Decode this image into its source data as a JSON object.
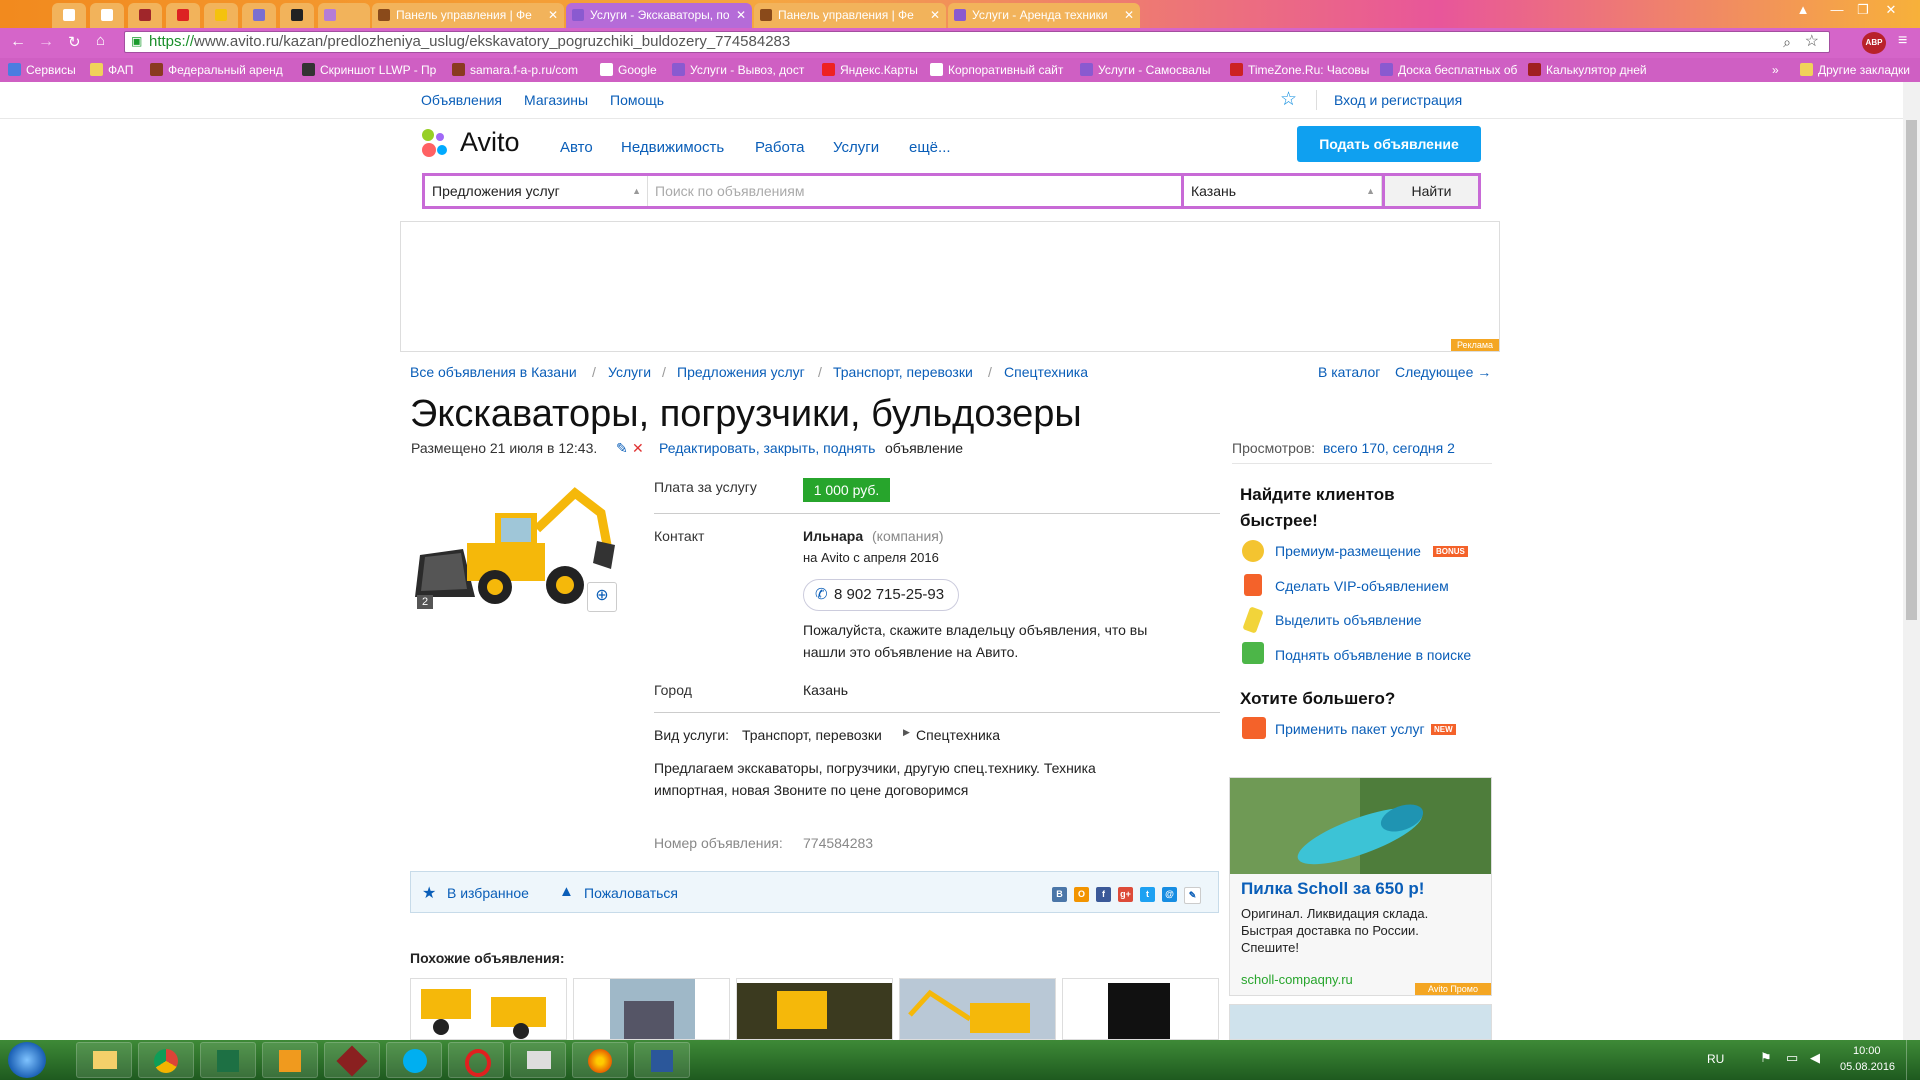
{
  "browser": {
    "tabs": [
      {
        "label": "",
        "pinned": true
      },
      {
        "label": "",
        "pinned": true
      },
      {
        "label": "",
        "pinned": true
      },
      {
        "label": "",
        "pinned": true
      },
      {
        "label": "",
        "pinned": true
      },
      {
        "label": "",
        "pinned": true
      },
      {
        "label": "",
        "pinned": true
      },
      {
        "label": "Панель управления | Фе",
        "pinned": false
      },
      {
        "label": "Услуги - Экскаваторы, по",
        "pinned": false,
        "active": true
      },
      {
        "label": "Панель управления | Фе",
        "pinned": false
      },
      {
        "label": "Услуги - Аренда техники",
        "pinned": false
      }
    ],
    "url_scheme": "https://",
    "url_rest": "www.avito.ru/kazan/predlozheniya_uslug/ekskavatory_pogruzchiki_buldozery_774584283",
    "extension_badge": "ABP 21",
    "bookmarks": [
      "Сервисы",
      "ФАП",
      "Федеральный аренд",
      "Скриншот LLWP - Пр",
      "samara.f-a-p.ru/com",
      "Google",
      "Услуги - Вывоз, дост",
      "Яндекс.Карты",
      "Корпоративный сайт",
      "Услуги - Самосвалы",
      "TimeZone.Ru: Часовы",
      "Доска бесплатных об",
      "Калькулятор дней"
    ],
    "other_bookmarks": "Другие закладки",
    "more_bookmarks": "»"
  },
  "header": {
    "top_links": [
      "Объявления",
      "Магазины",
      "Помощь"
    ],
    "login": "Вход и регистрация",
    "logo_text": "Avito",
    "nav": [
      "Авто",
      "Недвижимость",
      "Работа",
      "Услуги",
      "ещё..."
    ],
    "post_button": "Подать объявление"
  },
  "search": {
    "category": "Предложения услуг",
    "placeholder": "Поиск по объявлениям",
    "city": "Казань",
    "button": "Найти"
  },
  "ad_label": "Реклама",
  "breadcrumbs": [
    "Все объявления в Казани",
    "Услуги",
    "Предложения услуг",
    "Транспорт, перевозки",
    "Спецтехника"
  ],
  "catalog_link": "В каталог",
  "next_link": "Следующее →",
  "listing": {
    "title": "Экскаваторы, погрузчики, бульдозеры",
    "posted": "Размещено 21 июля в 12:43.",
    "edit_link": "Редактировать, закрыть, поднять",
    "edit_suffix": "объявление",
    "views_label": "Просмотров:",
    "views_value": "всего 170, сегодня 2",
    "photo_count": "2",
    "price_label": "Плата за услугу",
    "price": "1 000 руб.",
    "contact_label": "Контакт",
    "contact_name": "Ильнара",
    "contact_type": "(компания)",
    "contact_since": "на Avito с апреля 2016",
    "phone": "8 902 715-25-93",
    "phone_note_1": "Пожалуйста, скажите владельцу объявления, что вы",
    "phone_note_2": "нашли это объявление на Авито.",
    "city_label": "Город",
    "city_value": "Казань",
    "service_label": "Вид услуги:",
    "service_value": "Транспорт, перевозки",
    "service_sub": "Спецтехника",
    "desc_1": "Предлагаем экскаваторы, погрузчики, другую спец.технику. Техника",
    "desc_2": "импортная, новая Звоните по цене договоримся",
    "number_label": "Номер объявления:",
    "number_value": "774584283",
    "favorite": "В избранное",
    "report": "Пожаловаться",
    "share_icons": [
      "В",
      "О",
      "f",
      "g+",
      "t",
      "@",
      "✎"
    ],
    "similar_title": "Похожие объявления:"
  },
  "sidebar": {
    "title_1": "Найдите клиентов",
    "title_2": "быстрее!",
    "links": [
      {
        "label": "Премиум-размещение",
        "badge": "BONUS",
        "icon_color": "#f4c430"
      },
      {
        "label": "Сделать VIP-объявлением",
        "badge": "",
        "icon_color": "#f4622a"
      },
      {
        "label": "Выделить объявление",
        "badge": "",
        "icon_color": "#f2d43a"
      },
      {
        "label": "Поднять объявление в поиске",
        "badge": "",
        "icon_color": "#4cb648"
      }
    ],
    "more_title": "Хотите большего?",
    "package_link": "Применить пакет услуг",
    "package_badge": "NEW",
    "promo_title": "Пилка Scholl за 650 р!",
    "promo_text_1": "Оригинал. Ликвидация склада.",
    "promo_text_2": "Быстрая доставка по России.",
    "promo_text_3": "Спешите!",
    "promo_site": "scholl-compaqny.ru",
    "promo_label": "Avito Промо"
  },
  "taskbar": {
    "lang": "RU",
    "time": "10:00",
    "date": "05.08.2016",
    "apps": [
      "explorer",
      "chrome",
      "excel",
      "outlook",
      "fap",
      "skype",
      "opera",
      "fax",
      "firefox",
      "word"
    ]
  }
}
